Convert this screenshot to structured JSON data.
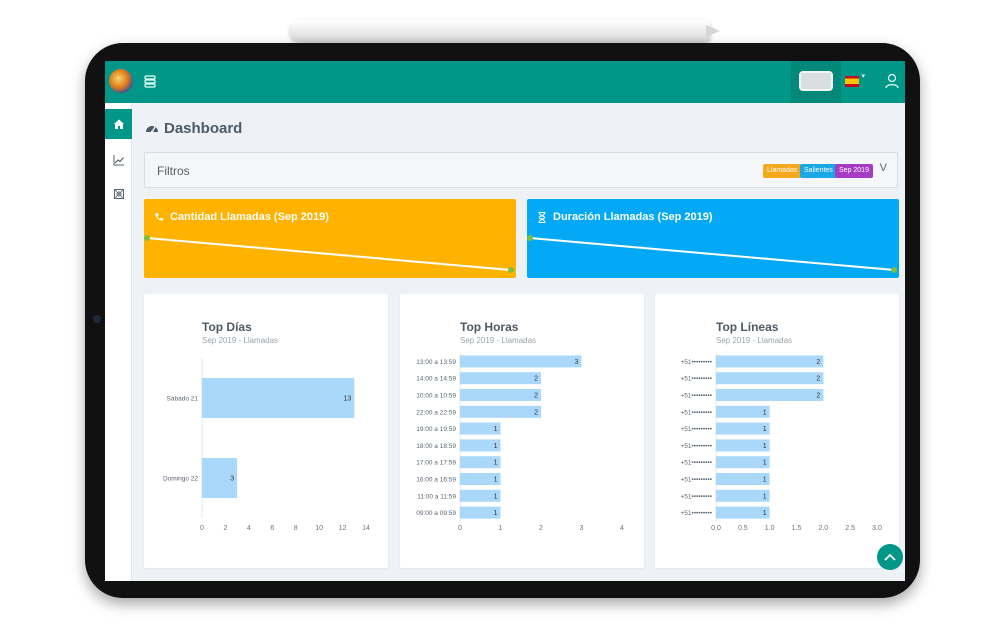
{
  "nav": {
    "sidebar_items": [
      "home",
      "chart",
      "report"
    ]
  },
  "page": {
    "title": "Dashboard"
  },
  "filters": {
    "label": "Filtros",
    "badges": [
      {
        "text": "Llamadas",
        "color": "#f4a91d"
      },
      {
        "text": "Salientes",
        "color": "#1aa7e6"
      },
      {
        "text": "Sep 2019",
        "color": "#a63bc4"
      }
    ],
    "toggle": "V"
  },
  "kpis": [
    {
      "title": "Cantidad Llamadas (Sep 2019)",
      "color": "#ffb300",
      "icon": "phone-icon"
    },
    {
      "title": "Duración Llamadas (Sep 2019)",
      "color": "#03a9f4",
      "icon": "hourglass-icon"
    }
  ],
  "colors": {
    "accent": "#009688",
    "bar": "#a9d8fa",
    "spark_dot": "#7cc13e"
  },
  "chart_data": [
    {
      "type": "bar",
      "orientation": "horizontal",
      "title": "Top Días",
      "subtitle": "Sep 2019 - Llamadas",
      "categories": [
        "Sábado 21",
        "Domingo 22"
      ],
      "values": [
        13,
        3
      ],
      "xlim": [
        0,
        14
      ],
      "ticks": [
        0,
        2,
        4,
        6,
        8,
        10,
        12,
        14
      ]
    },
    {
      "type": "bar",
      "orientation": "horizontal",
      "title": "Top Horas",
      "subtitle": "Sep 2019 - Llamadas",
      "categories": [
        "13:00 a 13:59",
        "14:00 a 14:59",
        "10:00 a 10:59",
        "22:00 a 22:59",
        "19:00 a 19:59",
        "18:00 a 18:59",
        "17:00 a 17:59",
        "16:00 a 16:59",
        "11:00 a 11:59",
        "09:00 a 09:59"
      ],
      "values": [
        3,
        2,
        2,
        2,
        1,
        1,
        1,
        1,
        1,
        1
      ],
      "xlim": [
        0,
        4
      ],
      "ticks": [
        0,
        1,
        2,
        3,
        4
      ]
    },
    {
      "type": "bar",
      "orientation": "horizontal",
      "title": "Top Líneas",
      "subtitle": "Sep 2019 - Llamadas",
      "categories": [
        "+51•••••••••",
        "+51•••••••••",
        "+51•••••••••",
        "+51•••••••••",
        "+51•••••••••",
        "+51•••••••••",
        "+51•••••••••",
        "+51•••••••••",
        "+51•••••••••",
        "+51•••••••••"
      ],
      "values": [
        2,
        2,
        2,
        1,
        1,
        1,
        1,
        1,
        1,
        1
      ],
      "xlim": [
        0,
        3
      ],
      "ticks": [
        "0.0",
        "0.5",
        "1.0",
        "1.5",
        "2.0",
        "2.5",
        "3.0"
      ]
    }
  ]
}
